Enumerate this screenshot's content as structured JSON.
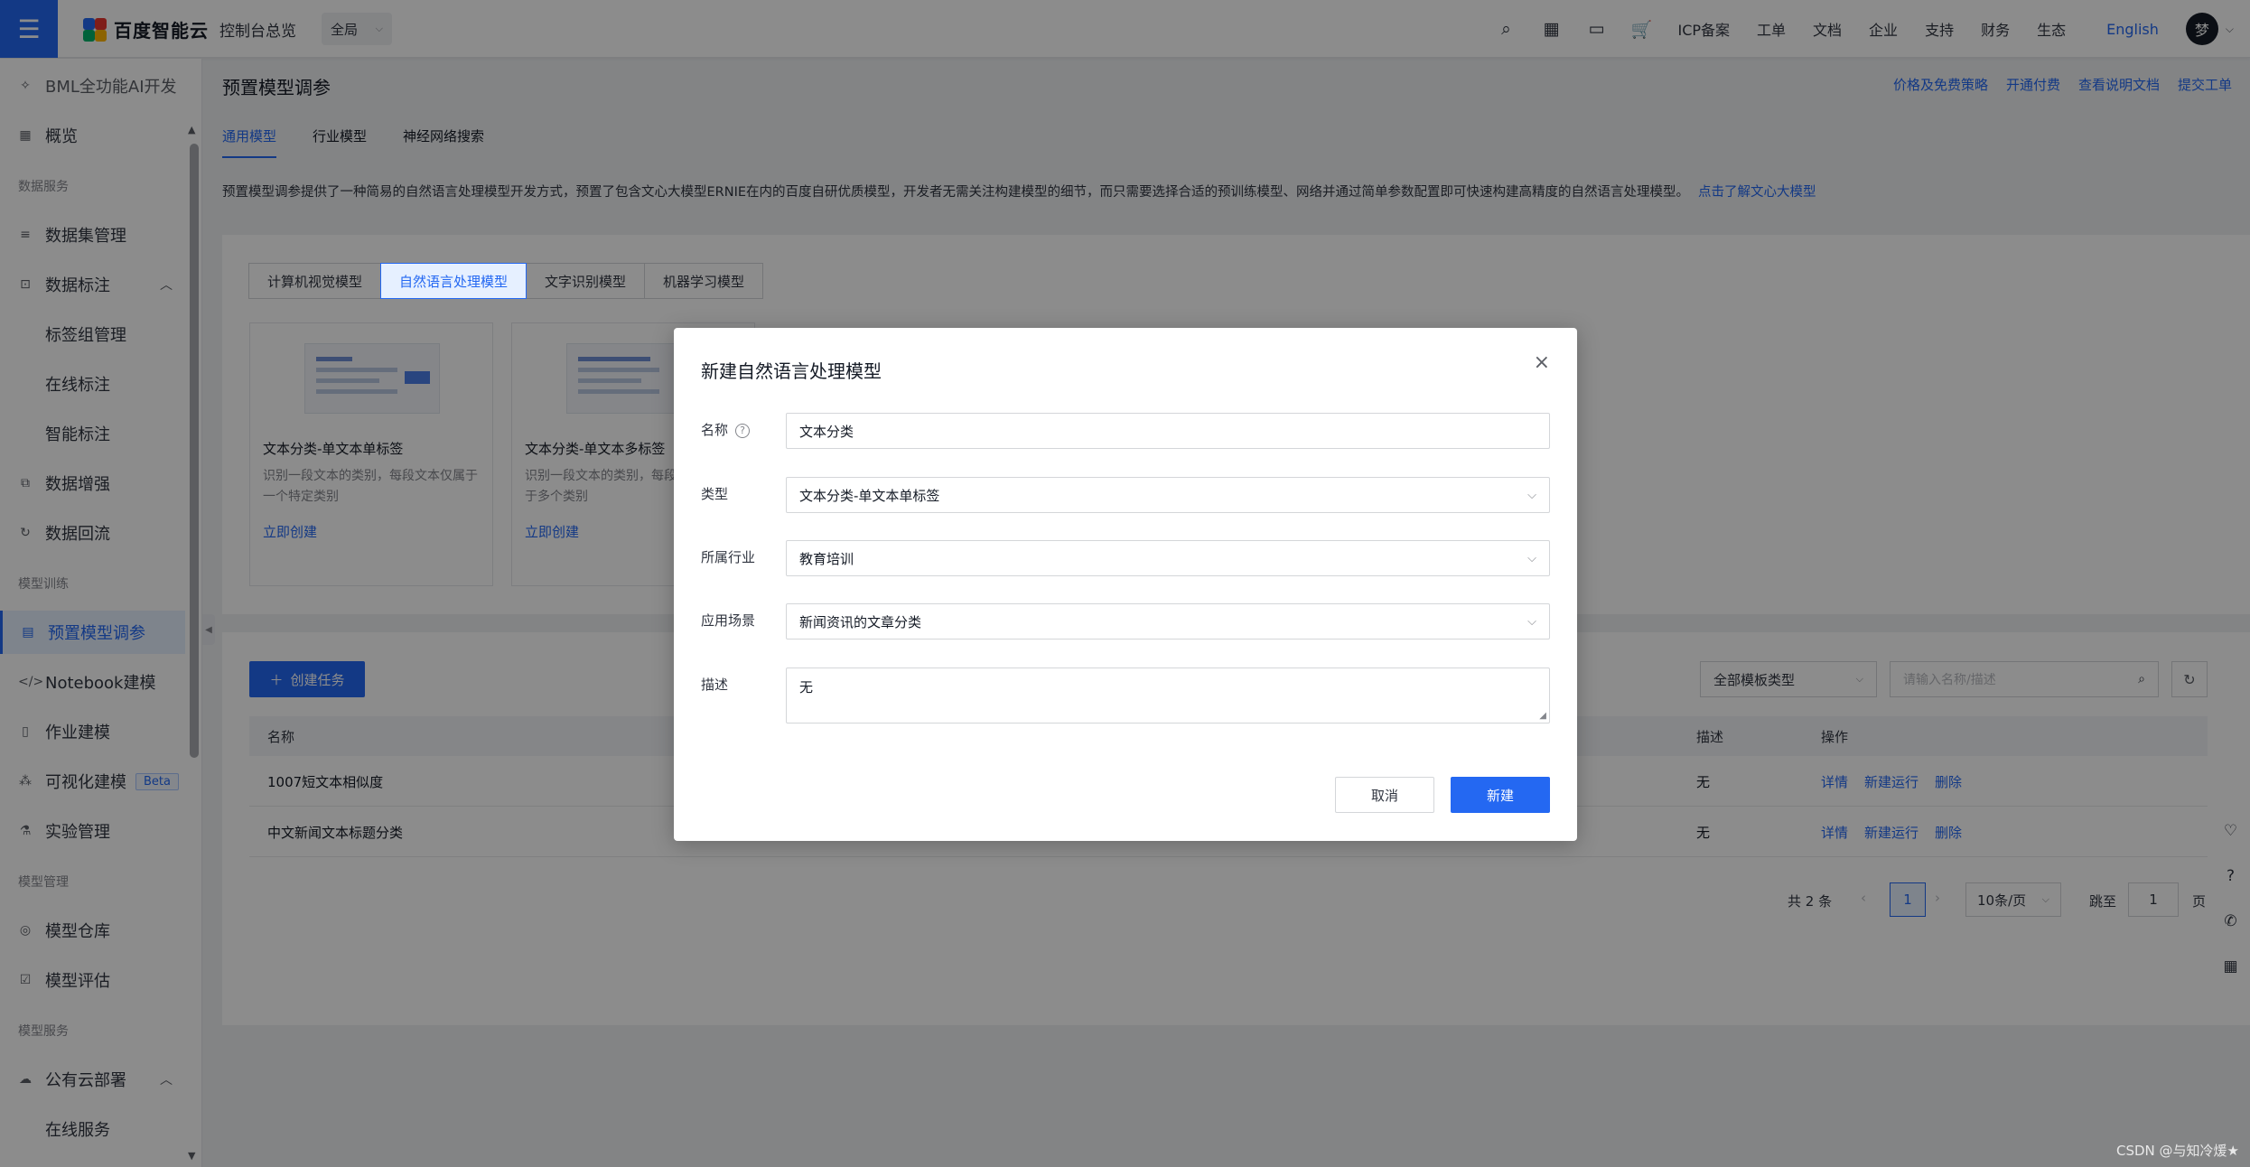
{
  "topbar": {
    "logo_text": "百度智能云",
    "console": "控制台总览",
    "region": "全局",
    "nav": [
      "ICP备案",
      "工单",
      "文档",
      "企业",
      "支持",
      "财务",
      "生态"
    ],
    "lang": "English",
    "avatar": "梦"
  },
  "sidebar": {
    "header": "BML全功能AI开发",
    "overview": "概览",
    "group_data": "数据服务",
    "dataset_mgmt": "数据集管理",
    "data_label": "数据标注",
    "tag_group": "标签组管理",
    "online_label": "在线标注",
    "smart_label": "智能标注",
    "data_augment": "数据增强",
    "data_backflow": "数据回流",
    "group_train": "模型训练",
    "preset_tune": "预置模型调参",
    "notebook": "Notebook建模",
    "job_model": "作业建模",
    "visual_model": "可视化建模",
    "beta": "Beta",
    "experiment": "实验管理",
    "group_model": "模型管理",
    "model_repo": "模型仓库",
    "model_eval": "模型评估",
    "group_service": "模型服务",
    "public_deploy": "公有云部署",
    "online_service": "在线服务"
  },
  "main": {
    "title": "预置模型调参",
    "links": [
      "价格及免费策略",
      "开通付费",
      "查看说明文档",
      "提交工单"
    ],
    "tabs": [
      "通用模型",
      "行业模型",
      "神经网络搜索"
    ],
    "description": "预置模型调参提供了一种简易的自然语言处理模型开发方式，预置了包含文心大模型ERNIE在内的百度自研优质模型，开发者无需关注构建模型的细节，而只需要选择合适的预训练模型、网络并通过简单参数配置即可快速构建高精度的自然语言处理模型。",
    "description_link": "点击了解文心大模型",
    "subtabs": [
      "计算机视觉模型",
      "自然语言处理模型",
      "文字识别模型",
      "机器学习模型"
    ],
    "templates": [
      {
        "name": "文本分类-单文本单标签",
        "desc": "识别一段文本的类别，每段文本仅属于一个特定类别",
        "go": "立即创建"
      },
      {
        "name": "文本分类-单文本多标签",
        "desc": "识别一段文本的类别，每段文本可能属于多个类别",
        "go": "立即创建"
      }
    ],
    "create_task": "创建任务",
    "filter_type": "全部模板类型",
    "search_placeholder": "请输入名称/描述",
    "table_headers": {
      "name": "名称",
      "desc": "描述",
      "ops": "操作"
    },
    "rows": [
      {
        "name": "1007短文本相似度",
        "desc": "无",
        "ops": [
          "详情",
          "新建运行",
          "删除"
        ]
      },
      {
        "name": "中文新闻文本标题分类",
        "desc": "无",
        "ops": [
          "详情",
          "新建运行",
          "删除"
        ]
      }
    ],
    "pager": {
      "total": "共 2 条",
      "page": "1",
      "size": "10条/页",
      "jump": "跳至",
      "jump_val": "1",
      "unit": "页"
    }
  },
  "modal": {
    "title": "新建自然语言处理模型",
    "name_label": "名称",
    "name_value": "文本分类",
    "type_label": "类型",
    "type_value": "文本分类-单文本单标签",
    "industry_label": "所属行业",
    "industry_value": "教育培训",
    "scene_label": "应用场景",
    "scene_value": "新闻资讯的文章分类",
    "desc_label": "描述",
    "desc_value": "无",
    "cancel": "取消",
    "ok": "新建"
  },
  "watermark": "CSDN @与知冷煖★",
  "colors": {
    "accent": "#2468f2",
    "overlay": "rgba(0,0,0,0.45)"
  }
}
